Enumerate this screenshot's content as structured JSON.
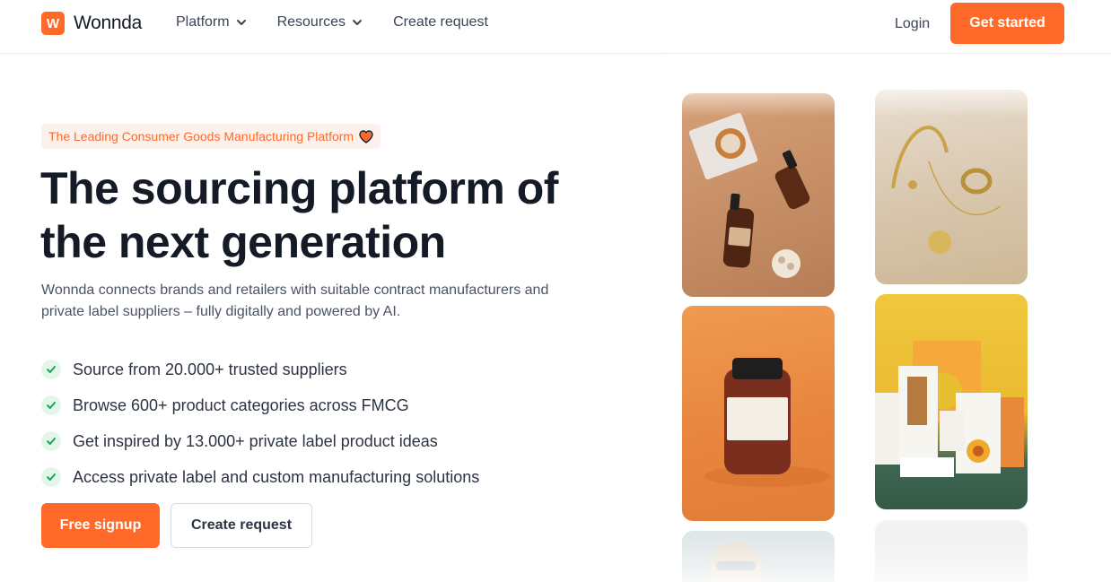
{
  "nav": {
    "logo_letter": "W",
    "logo_text": "Wonnda",
    "links": [
      {
        "label": "Platform"
      },
      {
        "label": "Resources"
      },
      {
        "label": "Create request"
      }
    ],
    "login": "Login",
    "cta": "Get started"
  },
  "hero": {
    "badge": "The Leading Consumer Goods Manufacturing Platform",
    "headline_line1": "The sourcing platform of",
    "headline_line2": "the next generation",
    "subtext": "Wonnda connects brands and retailers with suitable contract manufacturers and private label suppliers – fully digitally and powered by AI.",
    "features": [
      "Source from 20.000+ trusted suppliers",
      "Browse 600+ product categories across FMCG",
      "Get inspired by 13.000+ private label product ideas",
      "Access private label and custom manufacturing solutions"
    ],
    "primary_button": "Free signup",
    "secondary_button": "Create request"
  },
  "colors": {
    "accent": "#ff6a2b",
    "text_dark": "#151b26",
    "check_bg": "#e2f6ea",
    "check_mark": "#22a35a"
  },
  "icons": {
    "badge_icon": "heart-icon",
    "nav_dropdown_icon": "chevron-down-icon",
    "feature_icon": "check-icon"
  }
}
